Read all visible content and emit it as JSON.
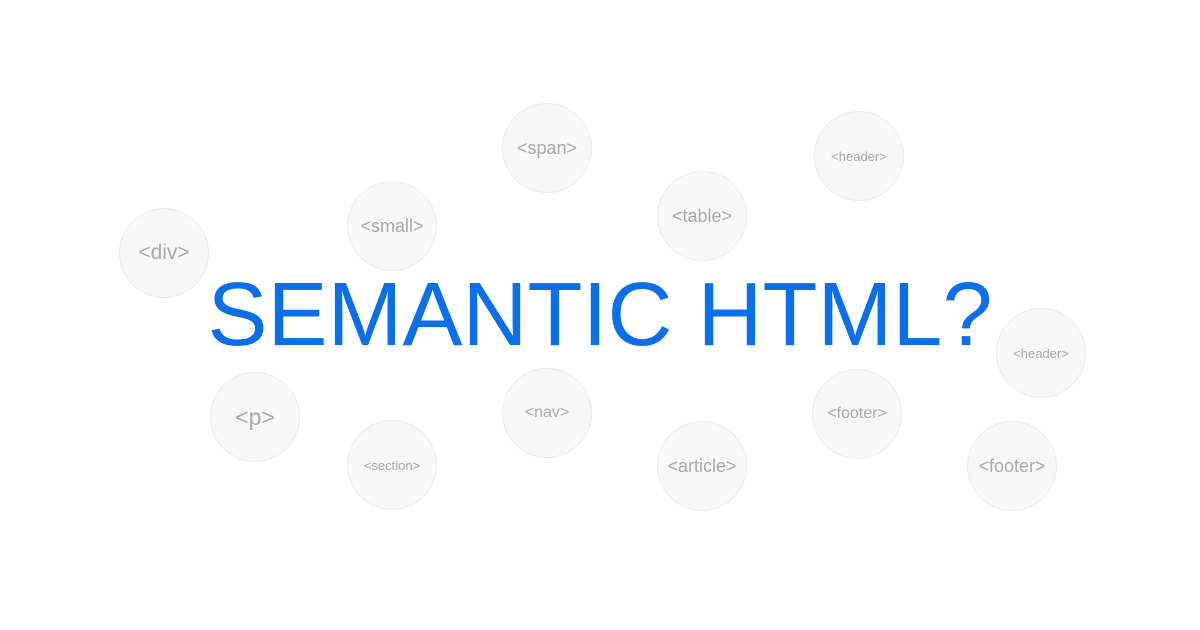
{
  "tags": {
    "span": "<span>",
    "header_top": "<header>",
    "small": "<small>",
    "table": "<table>",
    "div": "<div>",
    "header_right": "<header>",
    "p": "<p>",
    "nav": "<nav>",
    "footer_center": "<footer>",
    "section": "<section>",
    "article": "<article>",
    "footer_right": "<footer>"
  },
  "headline": "SEMANTIC HTML?",
  "colors": {
    "headline": "#0a6fe8",
    "bubble_fill": "#f8f8f8",
    "bubble_text": "#a9a9a9",
    "background": "#ffffff"
  }
}
